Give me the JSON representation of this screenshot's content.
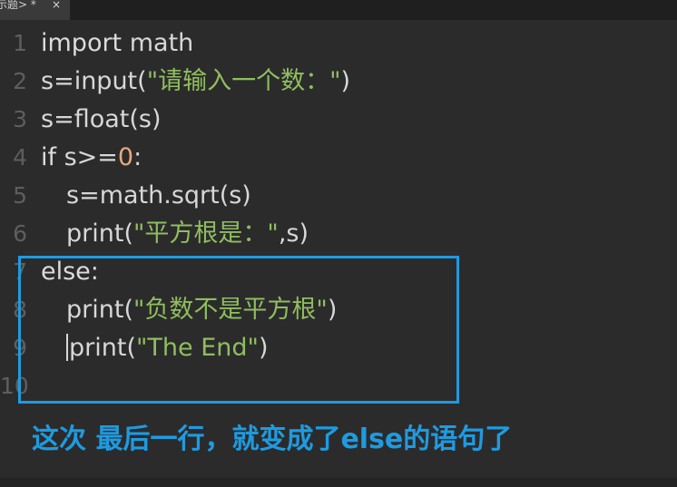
{
  "tab": {
    "label": "示题>",
    "modified_marker": "*",
    "close": "×"
  },
  "editor": {
    "line_numbers": [
      "1",
      "2",
      "3",
      "4",
      "5",
      "6",
      "7",
      "8",
      "9",
      "10"
    ],
    "lines": [
      {
        "parts": [
          {
            "t": "import",
            "c": "kw"
          },
          {
            "t": " math",
            "c": "plain"
          }
        ]
      },
      {
        "parts": [
          {
            "t": "s=input(",
            "c": "plain"
          },
          {
            "t": "\"请输入一个数：\"",
            "c": "str"
          },
          {
            "t": ")",
            "c": "plain"
          }
        ]
      },
      {
        "parts": [
          {
            "t": "s=float(s)",
            "c": "plain"
          }
        ]
      },
      {
        "parts": [
          {
            "t": "if",
            "c": "kw"
          },
          {
            "t": " s>=",
            "c": "plain"
          },
          {
            "t": "0",
            "c": "num"
          },
          {
            "t": ":",
            "c": "plain"
          }
        ]
      },
      {
        "parts": [
          {
            "t": "s=math.sqrt(s)",
            "c": "plain"
          }
        ]
      },
      {
        "parts": [
          {
            "t": "print(",
            "c": "plain"
          },
          {
            "t": "\"平方根是：\"",
            "c": "str"
          },
          {
            "t": ",s)",
            "c": "plain"
          }
        ]
      },
      {
        "parts": [
          {
            "t": "else",
            "c": "kw"
          },
          {
            "t": ":",
            "c": "plain"
          }
        ]
      },
      {
        "parts": [
          {
            "t": "print(",
            "c": "plain"
          },
          {
            "t": "\"负数不是平方根\"",
            "c": "str"
          },
          {
            "t": ")",
            "c": "plain"
          }
        ]
      },
      {
        "parts": [
          {
            "t": "print(",
            "c": "plain"
          },
          {
            "t": "\"The End\"",
            "c": "str"
          },
          {
            "t": ")",
            "c": "plain"
          }
        ]
      },
      {
        "parts": []
      }
    ]
  },
  "annotation": {
    "text": "这次 最后一行，就变成了else的语句了",
    "color": "#1e9be0"
  },
  "colors": {
    "background": "#2b2b2c",
    "string": "#8fbe5e",
    "number": "#e8a97a",
    "highlight": "#1e9be0"
  }
}
